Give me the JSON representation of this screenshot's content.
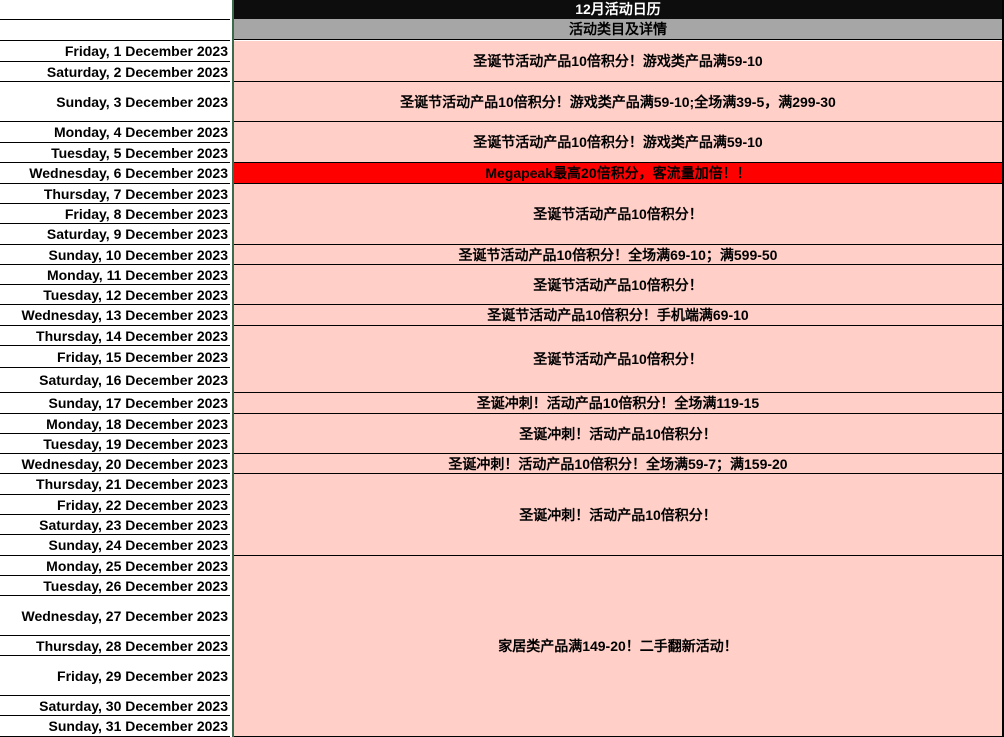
{
  "header": {
    "title": "12月活动日历",
    "subtitle": "活动类目及详情"
  },
  "colors": {
    "title_bg": "#0d0d0d",
    "subtitle_bg": "#a6a6a6",
    "event_bg": "#ffcfc8",
    "highlight_bg": "#ff0000"
  },
  "dates": [
    "Friday, 1 December 2023",
    "Saturday, 2 December 2023",
    "Sunday, 3 December 2023",
    "Monday, 4 December 2023",
    "Tuesday, 5 December 2023",
    "Wednesday, 6 December 2023",
    "Thursday, 7 December 2023",
    "Friday, 8 December 2023",
    "Saturday, 9 December 2023",
    "Sunday, 10 December 2023",
    "Monday, 11 December 2023",
    "Tuesday, 12 December 2023",
    "Wednesday, 13 December 2023",
    "Thursday, 14 December 2023",
    "Friday, 15 December 2023",
    "Saturday, 16 December 2023",
    "Sunday, 17 December 2023",
    "Monday, 18 December 2023",
    "Tuesday, 19 December 2023",
    "Wednesday, 20 December 2023",
    "Thursday, 21 December 2023",
    "Friday, 22 December 2023",
    "Saturday, 23 December 2023",
    "Sunday, 24 December 2023",
    "Monday, 25 December 2023",
    "Tuesday, 26 December 2023",
    "Wednesday, 27 December 2023",
    "Thursday, 28 December 2023",
    "Friday, 29 December 2023",
    "Saturday, 30 December 2023",
    "Sunday, 31 December 2023"
  ],
  "events": [
    {
      "days": "1-2",
      "text": "圣诞节活动产品10倍积分！游戏类产品满59-10",
      "highlight": false
    },
    {
      "days": "3",
      "text": "圣诞节活动产品10倍积分！游戏类产品满59-10;全场满39-5，满299-30",
      "highlight": false
    },
    {
      "days": "4-5",
      "text": "圣诞节活动产品10倍积分！游戏类产品满59-10",
      "highlight": false
    },
    {
      "days": "6",
      "text": "Megapeak最高20倍积分，客流量加倍！！",
      "highlight": true
    },
    {
      "days": "7-9",
      "text": "圣诞节活动产品10倍积分！",
      "highlight": false
    },
    {
      "days": "10",
      "text": "圣诞节活动产品10倍积分！全场满69-10；满599-50",
      "highlight": false
    },
    {
      "days": "11-12",
      "text": "圣诞节活动产品10倍积分！",
      "highlight": false
    },
    {
      "days": "13",
      "text": "圣诞节活动产品10倍积分！手机端满69-10",
      "highlight": false
    },
    {
      "days": "14-16",
      "text": "圣诞节活动产品10倍积分！",
      "highlight": false
    },
    {
      "days": "17",
      "text": "圣诞冲刺！活动产品10倍积分！全场满119-15",
      "highlight": false
    },
    {
      "days": "18-19",
      "text": "圣诞冲刺！活动产品10倍积分！",
      "highlight": false
    },
    {
      "days": "20",
      "text": "圣诞冲刺！活动产品10倍积分！全场满59-7；满159-20",
      "highlight": false
    },
    {
      "days": "21-24",
      "text": "圣诞冲刺！活动产品10倍积分！",
      "highlight": false
    },
    {
      "days": "25-31",
      "text": "家居类产品满149-20！二手翻新活动！",
      "highlight": false
    }
  ]
}
